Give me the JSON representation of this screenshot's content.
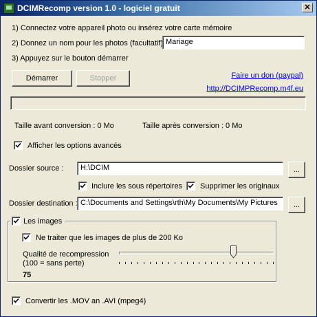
{
  "window": {
    "title": "DCIMRecomp version 1.0 - logiciel gratuit",
    "close_glyph": "✕"
  },
  "steps": {
    "step1": "1) Connectez votre appareil photo ou insérez votre carte mémoire",
    "step2": "2) Donnez un nom pour les photos (facultatif)",
    "step2_value": "Mariage",
    "step3": "3) Appuyez sur le bouton démarrer"
  },
  "buttons": {
    "start": "Démarrer",
    "stop": "Stopper",
    "browse": "..."
  },
  "links": {
    "donate": "Faire un don (paypal)",
    "website": "http://DCIMPRecomp.m4f.eu"
  },
  "progress": {
    "value": 0
  },
  "sizes": {
    "before": "Taille avant conversion : 0 Mo",
    "after": "Taille après conversion : 0 Mo"
  },
  "advanced": {
    "label": "Afficher les options avancés",
    "checked": true
  },
  "source": {
    "label": "Dossier source :",
    "value": "H:\\DCIM",
    "include_subdirs": {
      "label": "Inclure les sous répertoires",
      "checked": true
    },
    "delete_originals": {
      "label": "Supprimer les originaux",
      "checked": true
    }
  },
  "destination": {
    "label": "Dossier destination :",
    "value": "C:\\Documents and Settings\\rth\\My Documents\\My Pictures"
  },
  "images": {
    "group_label": "Les images",
    "checked": true,
    "only_large": {
      "label": "Ne traiter que les images de plus de 200 Ko",
      "checked": true
    },
    "quality_label_line1": "Qualité de recompression",
    "quality_label_line2": "(100 = sans perte)",
    "quality_value": "75",
    "quality_numeric": 75
  },
  "convert_mov": {
    "label": "Convertir les .MOV an .AVI (mpeg4)",
    "checked": true
  },
  "colors": {
    "title_start": "#0a246a",
    "title_end": "#a6caf0",
    "face": "#ece9d8",
    "link": "#0000ee"
  },
  "icons": {
    "app": "app-icon",
    "check": "check-icon",
    "close": "close-icon",
    "thumb": "slider-thumb-icon"
  }
}
